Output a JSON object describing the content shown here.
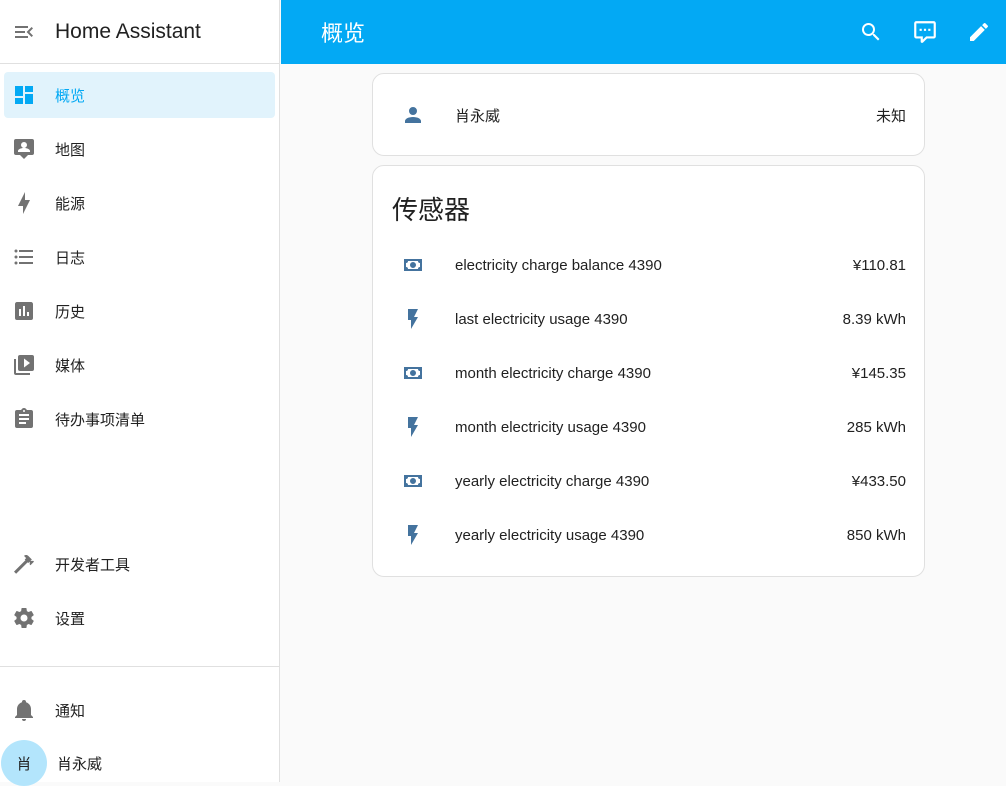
{
  "app": {
    "title": "Home Assistant"
  },
  "sidebar": {
    "items": [
      {
        "label": "概览",
        "icon": "dashboard-icon",
        "active": true
      },
      {
        "label": "地图",
        "icon": "map-account-icon"
      },
      {
        "label": "能源",
        "icon": "lightning-bolt-icon"
      },
      {
        "label": "日志",
        "icon": "format-list-bulleted-icon"
      },
      {
        "label": "历史",
        "icon": "chart-box-icon"
      },
      {
        "label": "媒体",
        "icon": "play-box-multiple-icon"
      },
      {
        "label": "待办事项清单",
        "icon": "clipboard-list-icon"
      }
    ],
    "bottom_items": [
      {
        "label": "开发者工具",
        "icon": "hammer-icon"
      },
      {
        "label": "设置",
        "icon": "cog-icon"
      }
    ],
    "notifications": {
      "label": "通知",
      "icon": "bell-icon"
    },
    "user": {
      "initial": "肖",
      "name": "肖永威"
    }
  },
  "header": {
    "title": "概览"
  },
  "person_card": {
    "name": "肖永威",
    "state": "未知"
  },
  "sensors_card": {
    "title": "传感器",
    "rows": [
      {
        "name": "electricity charge balance 4390",
        "value": "¥110.81",
        "icon": "cash-icon"
      },
      {
        "name": "last electricity usage 4390",
        "value": "8.39 kWh",
        "icon": "flash-icon"
      },
      {
        "name": "month electricity charge 4390",
        "value": "¥145.35",
        "icon": "cash-icon"
      },
      {
        "name": "month electricity usage 4390",
        "value": "285 kWh",
        "icon": "flash-icon"
      },
      {
        "name": "yearly electricity charge 4390",
        "value": "¥433.50",
        "icon": "cash-icon"
      },
      {
        "name": "yearly electricity usage 4390",
        "value": "850 kWh",
        "icon": "flash-icon"
      }
    ]
  },
  "colors": {
    "primary": "#03a9f4",
    "sidebar_icon": "#727272",
    "state_icon": "#44739e"
  }
}
